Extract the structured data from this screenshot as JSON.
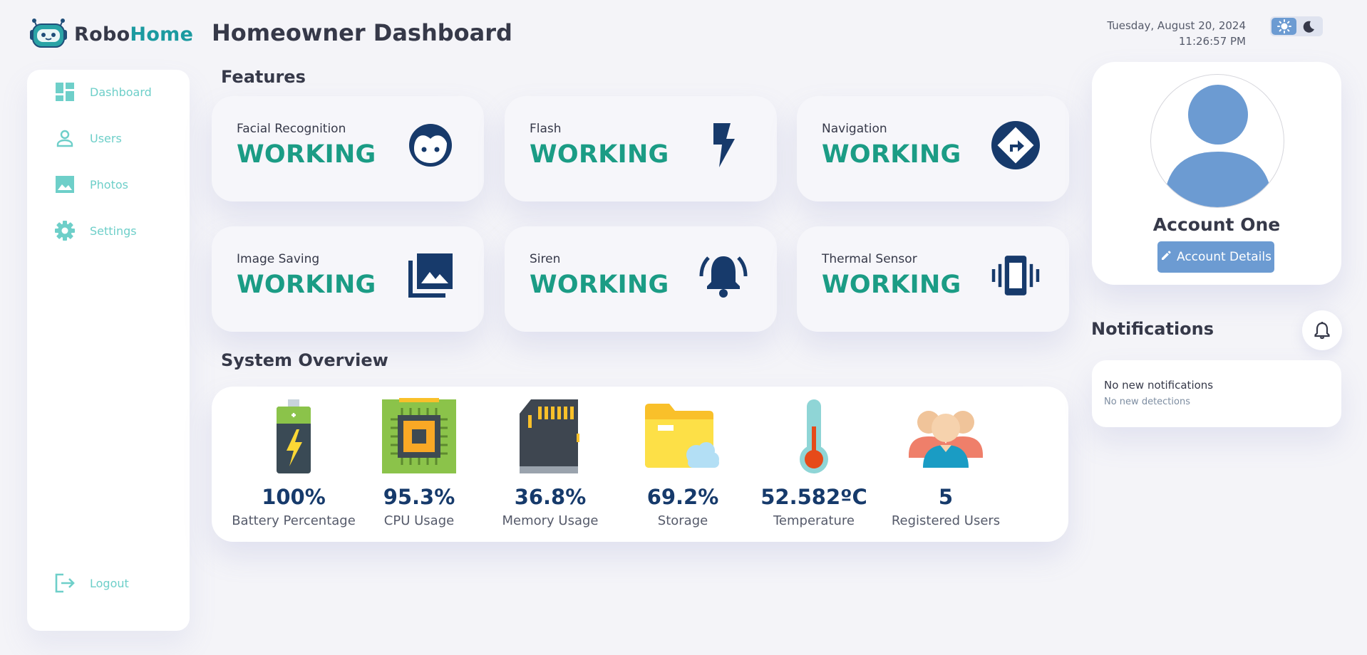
{
  "brand": {
    "name_part1": "Robo",
    "name_part2": "Home"
  },
  "header": {
    "title": "Homeowner Dashboard",
    "date": "Tuesday, August 20, 2024",
    "time": "11:26:57 PM",
    "theme_mode": "light"
  },
  "sidebar": {
    "items": [
      {
        "label": "Dashboard",
        "icon": "dashboard-icon"
      },
      {
        "label": "Users",
        "icon": "user-icon"
      },
      {
        "label": "Photos",
        "icon": "image-icon"
      },
      {
        "label": "Settings",
        "icon": "gear-icon"
      }
    ],
    "logout": {
      "label": "Logout",
      "icon": "logout-icon"
    }
  },
  "features": {
    "title": "Features",
    "cards": [
      {
        "label": "Facial Recognition",
        "status": "WORKING",
        "icon": "face-icon"
      },
      {
        "label": "Flash",
        "status": "WORKING",
        "icon": "bolt-icon"
      },
      {
        "label": "Navigation",
        "status": "WORKING",
        "icon": "directions-icon"
      },
      {
        "label": "Image Saving",
        "status": "WORKING",
        "icon": "photo-library-icon"
      },
      {
        "label": "Siren",
        "status": "WORKING",
        "icon": "bell-ringing-icon"
      },
      {
        "label": "Thermal Sensor",
        "status": "WORKING",
        "icon": "vibration-icon"
      }
    ]
  },
  "overview": {
    "title": "System Overview",
    "stats": [
      {
        "value": "100%",
        "label": "Battery Percentage",
        "icon": "battery-icon"
      },
      {
        "value": "95.3%",
        "label": "CPU Usage",
        "icon": "cpu-icon"
      },
      {
        "value": "36.8%",
        "label": "Memory Usage",
        "icon": "memory-card-icon"
      },
      {
        "value": "69.2%",
        "label": "Storage",
        "icon": "cloud-folder-icon"
      },
      {
        "value": "52.582ºC",
        "label": "Temperature",
        "icon": "thermometer-icon"
      },
      {
        "value": "5",
        "label": "Registered Users",
        "icon": "users-group-icon"
      }
    ]
  },
  "profile": {
    "name": "Account One",
    "button_label": "Account Details"
  },
  "notifications": {
    "title": "Notifications",
    "message_title": "No new notifications",
    "message_sub": "No new detections"
  },
  "colors": {
    "accent": "#1b9c85",
    "sidebar_text": "#6ecfc9",
    "icon_navy": "#173a6b",
    "button": "#6c9bd2"
  }
}
